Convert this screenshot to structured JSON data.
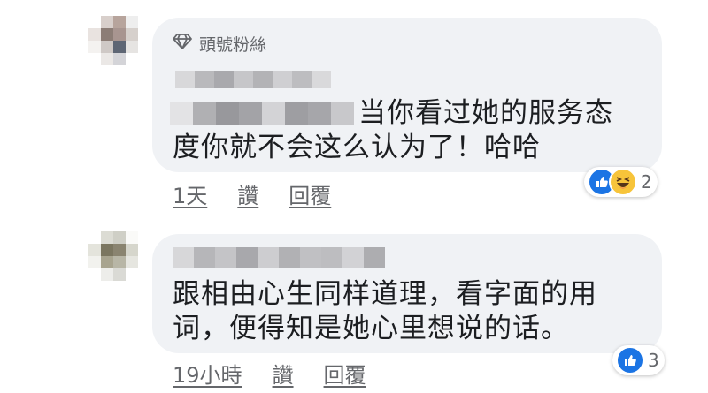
{
  "comments": [
    {
      "badge_label": "頭號粉絲",
      "text_line1": "当你看过她的服务态",
      "text_line2": "度你就不会这么认为了！哈哈",
      "time": "1天",
      "like_label": "讚",
      "reply_label": "回覆",
      "reaction_icons": [
        "like-icon",
        "haha-icon"
      ],
      "reaction_count": "2"
    },
    {
      "text_line1": "跟相由心生同样道理，看字面的用",
      "text_line2": "词，便得知是她心里想说的话。",
      "time": "19小時",
      "like_label": "讚",
      "reply_label": "回覆",
      "reaction_icons": [
        "like-icon"
      ],
      "reaction_count": "3"
    }
  ],
  "colors": {
    "bubble": "#f0f2f5",
    "secondary_text": "#65676b",
    "like_blue": "#1b74e4",
    "haha_yellow": "#f7c43a"
  }
}
